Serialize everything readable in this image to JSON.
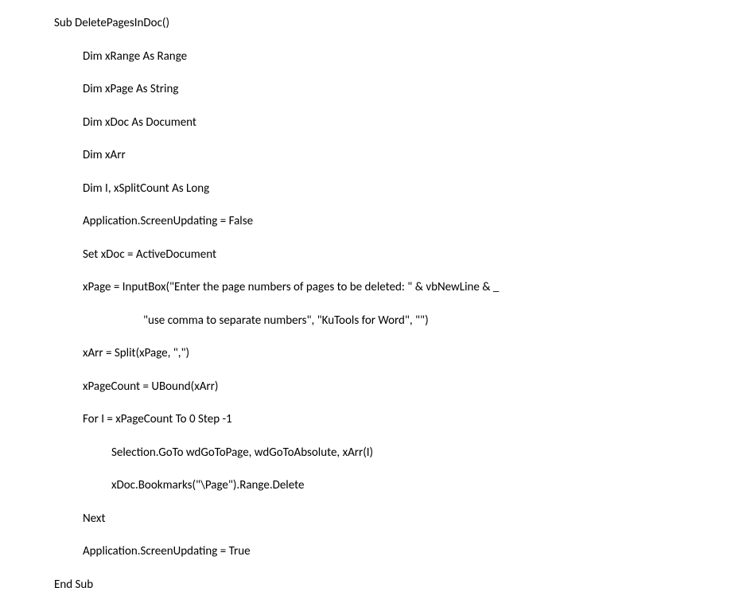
{
  "code": {
    "l1": "Sub DeletePagesInDoc()",
    "l2": "Dim xRange As Range",
    "l3": "Dim xPage As String",
    "l4": "Dim xDoc As Document",
    "l5": "Dim xArr",
    "l6": "Dim I, xSplitCount As Long",
    "l7": "Application.ScreenUpdating = False",
    "l8": "Set xDoc = ActiveDocument",
    "l9": "xPage = InputBox(\"Enter the page numbers of pages to be deleted: \" & vbNewLine & _",
    "l10": "\"use comma to separate numbers\", \"KuTools for Word\", \"\")",
    "l11": "xArr = Split(xPage, \",\")",
    "l12": "xPageCount = UBound(xArr)",
    "l13": "For I = xPageCount To 0 Step -1",
    "l14": "Selection.GoTo wdGoToPage, wdGoToAbsolute, xArr(I)",
    "l15": "xDoc.Bookmarks(\"\\Page\").Range.Delete",
    "l16": "Next",
    "l17": "Application.ScreenUpdating = True",
    "l18": "End Sub"
  }
}
